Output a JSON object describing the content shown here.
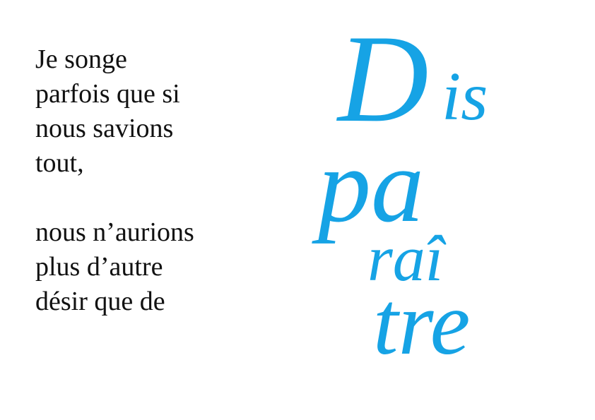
{
  "poem": {
    "lines": [
      "Je songe",
      "parfois que si",
      "nous savions",
      "tout,",
      "nous n’aurions",
      "plus d’autre",
      "désir que de"
    ]
  },
  "title_word": {
    "parts": [
      "D",
      "is",
      "pa",
      "raî",
      "tre"
    ]
  },
  "colors": {
    "accent": "#16a3e5",
    "text": "#111111",
    "background": "#ffffff"
  }
}
